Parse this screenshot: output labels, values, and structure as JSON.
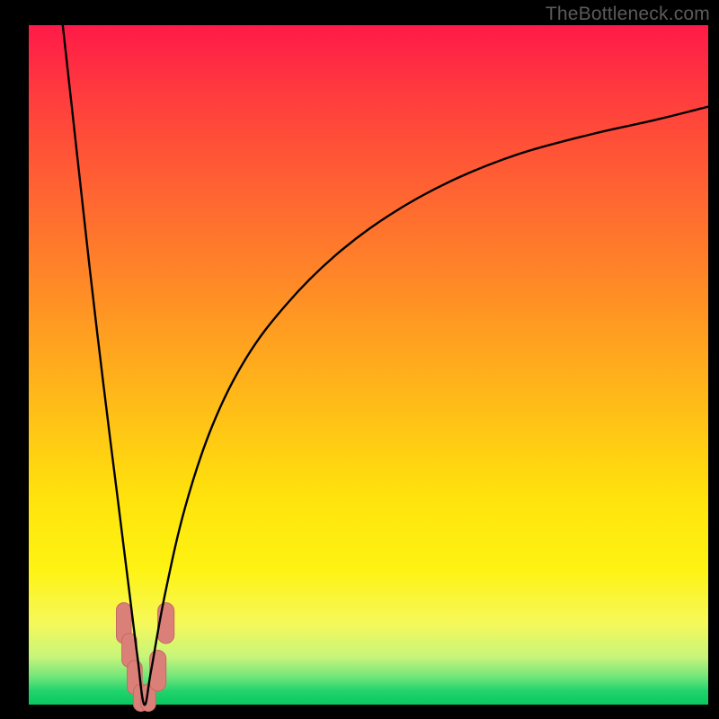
{
  "watermark": "TheBottleneck.com",
  "colors": {
    "frame": "#000000",
    "curve": "#000000",
    "marker_fill": "#db8079",
    "marker_stroke": "#c46a63"
  },
  "chart_data": {
    "type": "line",
    "title": "",
    "xlabel": "",
    "ylabel": "",
    "xlim": [
      0,
      100
    ],
    "ylim": [
      0,
      100
    ],
    "note": "Bottleneck-style V curve. x = relative hardware scale; y = bottleneck %. Minimum at x≈17 where y≈0. Curve is |log-like| shape: steep descent on left, slower ascent on right reaching ~88 at x=100.",
    "series": [
      {
        "name": "bottleneck_percent",
        "x": [
          5,
          7,
          9,
          11,
          13,
          15,
          16,
          17,
          18,
          20,
          23,
          27,
          32,
          38,
          45,
          53,
          62,
          72,
          83,
          92,
          100
        ],
        "y": [
          100,
          82,
          64,
          47,
          31,
          15,
          7,
          0,
          5,
          16,
          29,
          41,
          51,
          59,
          66,
          72,
          77,
          81,
          84,
          86,
          88
        ]
      }
    ],
    "markers": [
      {
        "x": 14.0,
        "y": 12,
        "w": 2.2,
        "h": 6
      },
      {
        "x": 14.8,
        "y": 8,
        "w": 2.2,
        "h": 5
      },
      {
        "x": 15.6,
        "y": 4,
        "w": 2.2,
        "h": 5
      },
      {
        "x": 16.5,
        "y": 1,
        "w": 2.2,
        "h": 4
      },
      {
        "x": 17.6,
        "y": 1,
        "w": 2.2,
        "h": 4
      },
      {
        "x": 19.0,
        "y": 5,
        "w": 2.4,
        "h": 6
      },
      {
        "x": 20.2,
        "y": 12,
        "w": 2.4,
        "h": 6
      }
    ]
  }
}
